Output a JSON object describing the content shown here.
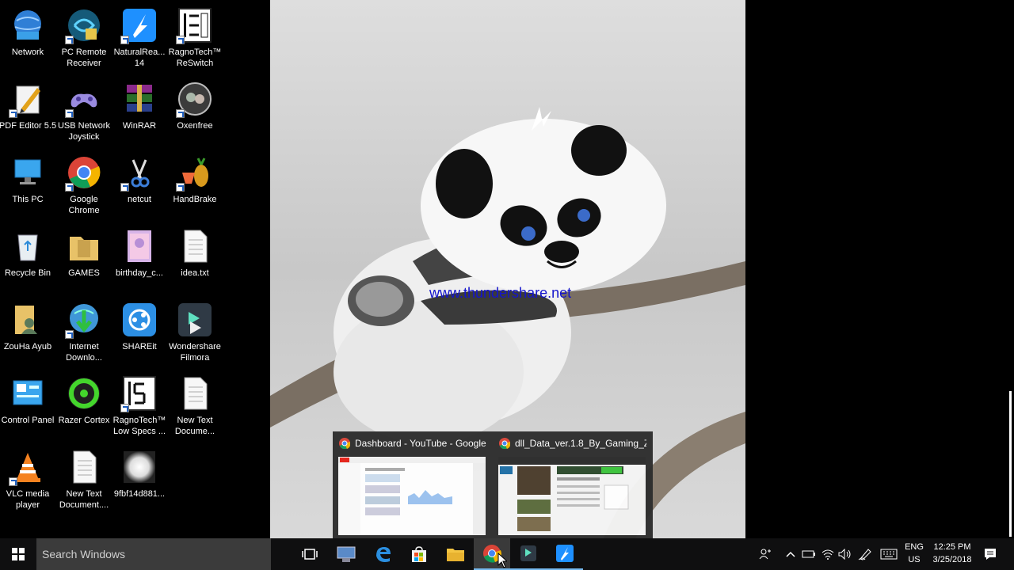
{
  "desktop": {
    "icons": [
      {
        "label": "Network",
        "icon": "network-icon"
      },
      {
        "label": "PC Remote Receiver",
        "icon": "pc-remote-icon"
      },
      {
        "label": "NaturalRea... 14",
        "icon": "naturalreader-icon"
      },
      {
        "label": "RagnoTech™ ReSwitch",
        "icon": "reswitch-icon"
      },
      {
        "label": "PDF Editor 5.5",
        "icon": "pdf-editor-icon"
      },
      {
        "label": "USB Network Joystick",
        "icon": "joystick-icon"
      },
      {
        "label": "WinRAR",
        "icon": "winrar-icon"
      },
      {
        "label": "Oxenfree",
        "icon": "oxenfree-icon"
      },
      {
        "label": "This PC",
        "icon": "this-pc-icon"
      },
      {
        "label": "Google Chrome",
        "icon": "chrome-icon"
      },
      {
        "label": "netcut",
        "icon": "netcut-icon"
      },
      {
        "label": "HandBrake",
        "icon": "handbrake-icon"
      },
      {
        "label": "Recycle Bin",
        "icon": "recycle-bin-icon"
      },
      {
        "label": "GAMES",
        "icon": "folder-icon"
      },
      {
        "label": "birthday_c...",
        "icon": "image-file-icon"
      },
      {
        "label": "idea.txt",
        "icon": "text-file-icon"
      },
      {
        "label": "ZouHa Ayub",
        "icon": "user-folder-icon"
      },
      {
        "label": "Internet Downlo...",
        "icon": "idm-icon"
      },
      {
        "label": "SHAREit",
        "icon": "shareit-icon"
      },
      {
        "label": "Wondershare Filmora",
        "icon": "filmora-icon"
      },
      {
        "label": "Control Panel",
        "icon": "control-panel-icon"
      },
      {
        "label": "Razer Cortex",
        "icon": "razer-cortex-icon"
      },
      {
        "label": "RagnoTech™ Low Specs ...",
        "icon": "lowspecs-icon"
      },
      {
        "label": "New Text Docume...",
        "icon": "text-file-icon"
      },
      {
        "label": "VLC media player",
        "icon": "vlc-icon"
      },
      {
        "label": "New Text Document....",
        "icon": "text-file-icon"
      },
      {
        "label": "9fbf14d881...",
        "icon": "image-file-icon"
      }
    ]
  },
  "wallpaper": {
    "watermark": "www.thundershare.net"
  },
  "taskbar": {
    "search_placeholder": "Search Windows",
    "language": {
      "line1": "ENG",
      "line2": "US"
    },
    "clock": {
      "time": "12:25 PM",
      "date": "3/25/2018"
    }
  },
  "thumbnails": [
    {
      "title": "Dashboard - YouTube - Google..."
    },
    {
      "title": "dll_Data_ver.1.8_By_Gaming_Zo..."
    }
  ],
  "colors": {
    "taskbar": "#0f0f10",
    "accent": "#1e90ff",
    "chrome_red": "#db4437",
    "chrome_green": "#0f9d58",
    "chrome_yellow": "#f4b400"
  }
}
